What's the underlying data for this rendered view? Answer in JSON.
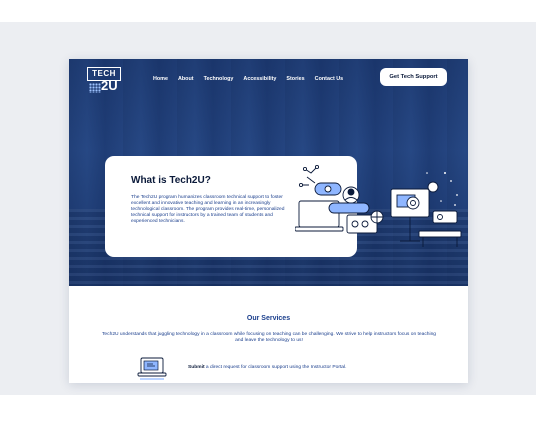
{
  "brand": {
    "logo_top": "TECH",
    "logo_bottom": "2U"
  },
  "nav": {
    "items": [
      "Home",
      "About",
      "Technology",
      "Accessibility",
      "Stories",
      "Contact Us"
    ],
    "cta": "Get Tech Support"
  },
  "hero": {
    "title": "What is Tech2U?",
    "body": "The Tech2U program humanizes classroom technical support to foster excellent and innovative teaching and learning in an increasingly technological classroom. The program provides real-time, personalized technical support for instructors by a trained team of students and experienced technicians."
  },
  "services": {
    "title": "Our Services",
    "description": "Tech2U understands that juggling technology in a classroom while focusing on teaching can be challenging. We strive to help instructors focus on teaching and leave the technology to us!",
    "submit_strong": "Submit",
    "submit_rest": " a direct request for classroom support using the Instructor Portal."
  },
  "colors": {
    "navy": "#1e3c78",
    "text_blue": "#1a3e8c",
    "dark": "#0b1a3a",
    "accent": "#2a6fdb"
  }
}
